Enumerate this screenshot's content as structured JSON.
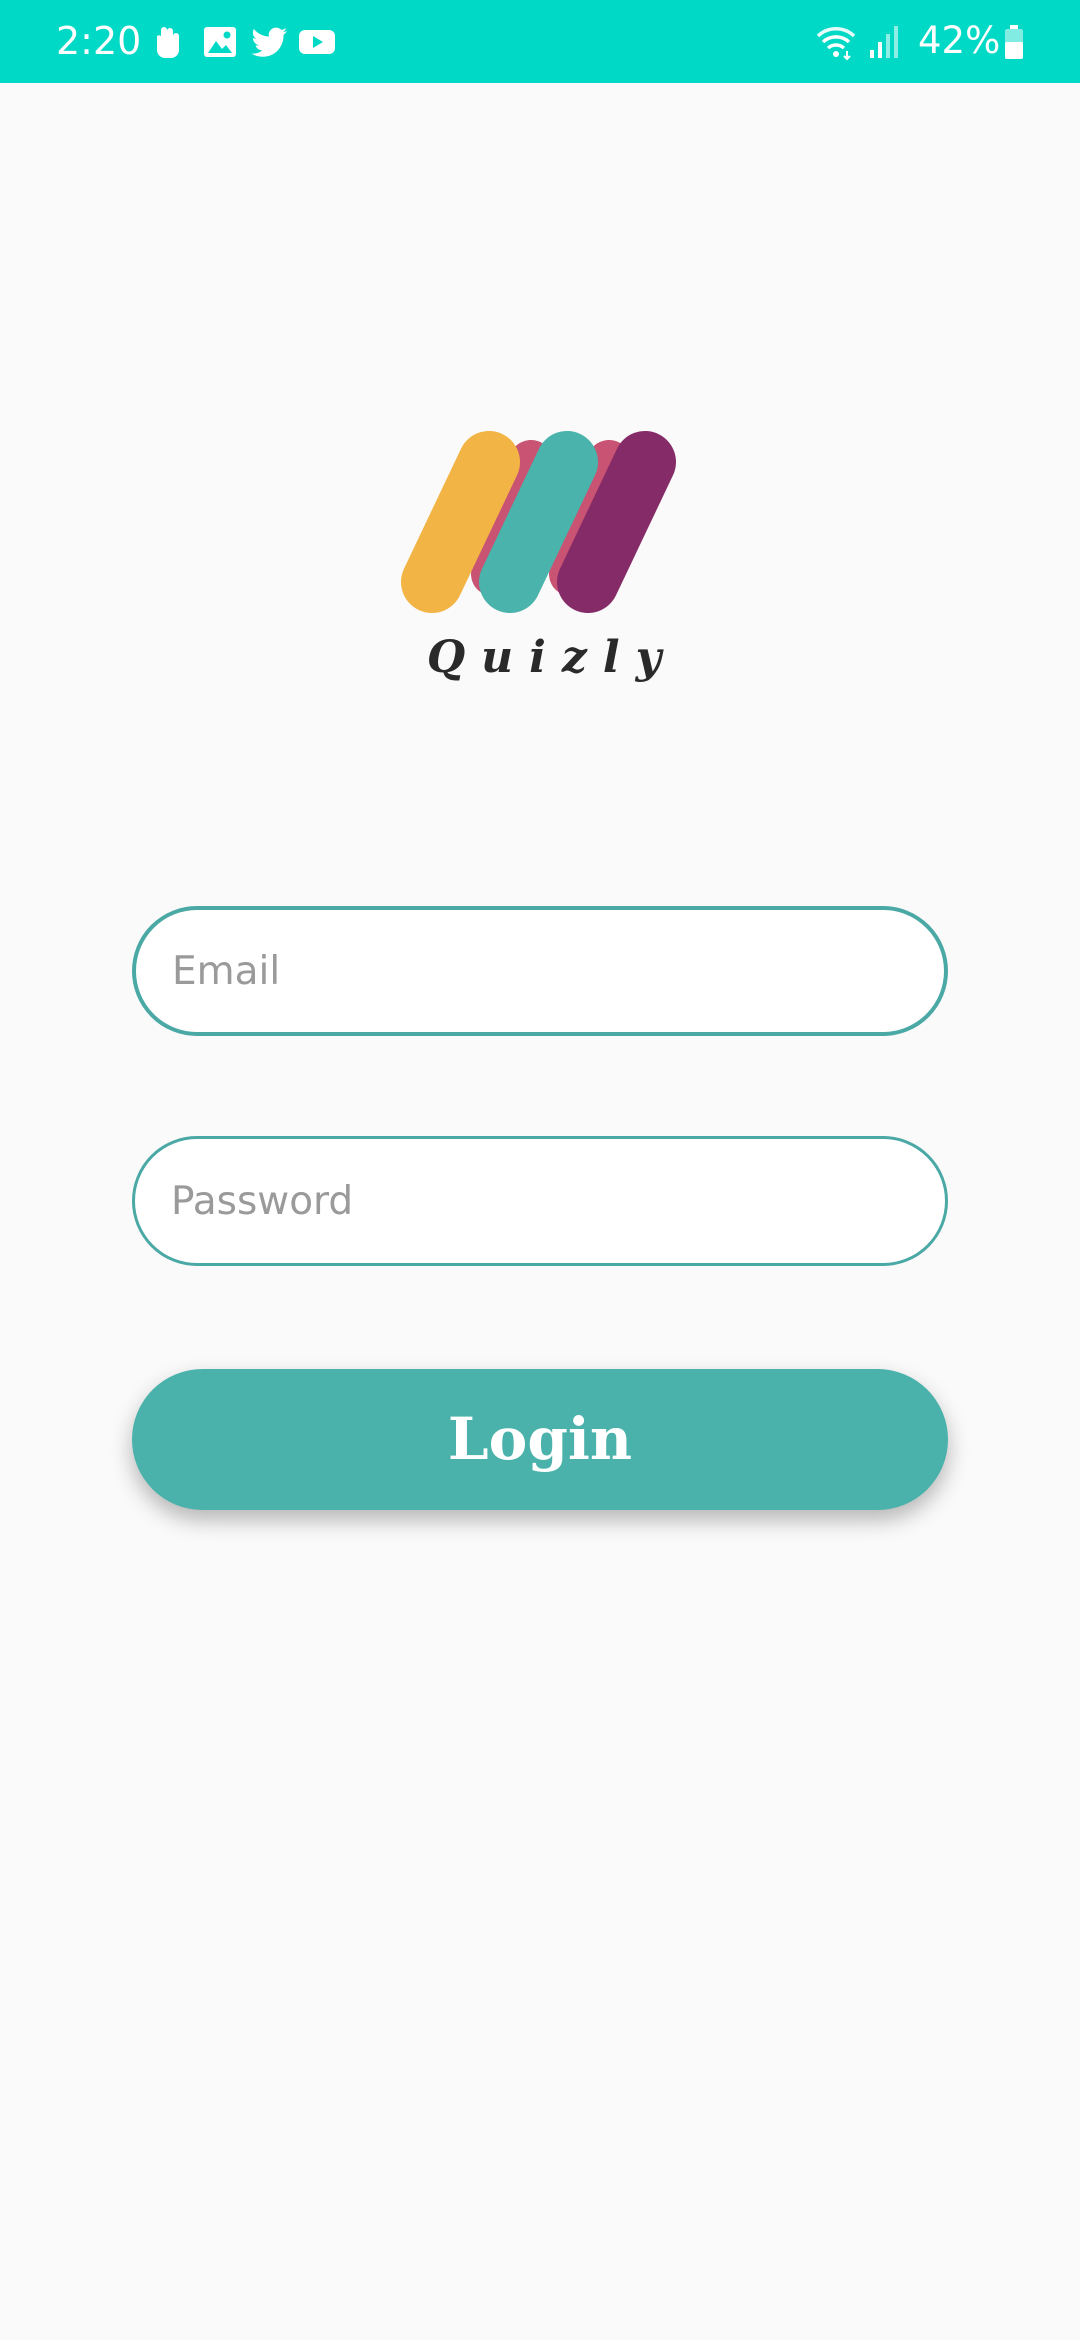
{
  "status_bar": {
    "time": "2:20",
    "notification_icons": [
      "hand-icon",
      "image-icon",
      "twitter-icon",
      "youtube-icon"
    ],
    "system_icons": [
      "wifi-icon",
      "signal-icon",
      "battery-icon"
    ],
    "battery_percent": "42%",
    "background_color": "#00d9c5"
  },
  "logo": {
    "name": "Quizly",
    "colors": {
      "yellow": "#f2b444",
      "pink": "#c85372",
      "teal": "#4ab3ab",
      "purple": "#852b68"
    }
  },
  "form": {
    "email": {
      "placeholder": "Email",
      "value": ""
    },
    "password": {
      "placeholder": "Password",
      "value": ""
    },
    "login_label": "Login"
  },
  "colors": {
    "accent": "#4bb2ab",
    "field_border": "#4aa8a5",
    "background": "#fafafa"
  }
}
